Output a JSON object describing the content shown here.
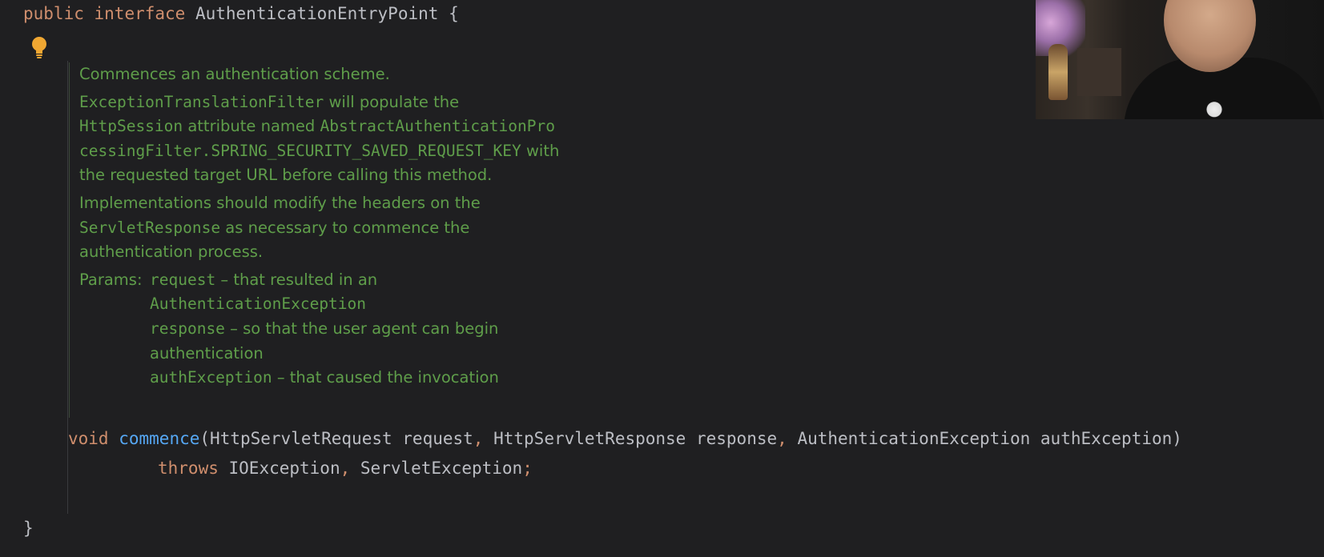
{
  "code": {
    "line1": {
      "kw_public": "public",
      "kw_interface": "interface",
      "type_name": "AuthenticationEntryPoint",
      "brace_open": "{"
    },
    "method": {
      "kw_void": "void",
      "name": "commence",
      "paren_open": "(",
      "p1_type": "HttpServletRequest",
      "p1_name": "request",
      "p2_type": "HttpServletResponse",
      "p2_name": "response",
      "p3_type": "AuthenticationException",
      "p3_name": "authException",
      "paren_close": ")",
      "comma": ","
    },
    "throws_line": {
      "kw_throws": "throws",
      "ex1": "IOException",
      "ex2": "ServletException",
      "semicolon": ";"
    },
    "brace_close": "}"
  },
  "doc": {
    "summary": "Commences an authentication scheme.",
    "p2_code1": "ExceptionTranslationFilter",
    "p2_text1": " will populate the ",
    "p2_code2": "HttpSession",
    "p2_text2": " attribute named ",
    "p2_code3": "AbstractAuthenticationProcessingFilter.SPRING_SECURITY_SAVED_REQUEST_KEY",
    "p2_text3": " with the requested target URL before calling this method.",
    "p3_text1": "Implementations should modify the headers on the ",
    "p3_code1": "ServletResponse",
    "p3_text2": " as necessary to commence the authentication process.",
    "params_label": "Params:",
    "params": [
      {
        "name": "request",
        "desc": " – that resulted in an ",
        "code": "AuthenticationException"
      },
      {
        "name": "response",
        "desc": " – so that the user agent can begin authentication",
        "code": ""
      },
      {
        "name": "authException",
        "desc": " – that caused the invocation",
        "code": ""
      }
    ]
  },
  "icons": {
    "bulb": "lightbulb-icon"
  },
  "colors": {
    "background": "#1f1f21",
    "keyword": "#cf8e6d",
    "method": "#56a8f5",
    "text": "#bcbec4",
    "doc": "#5f9e4a",
    "bulb": "#f0a732"
  }
}
